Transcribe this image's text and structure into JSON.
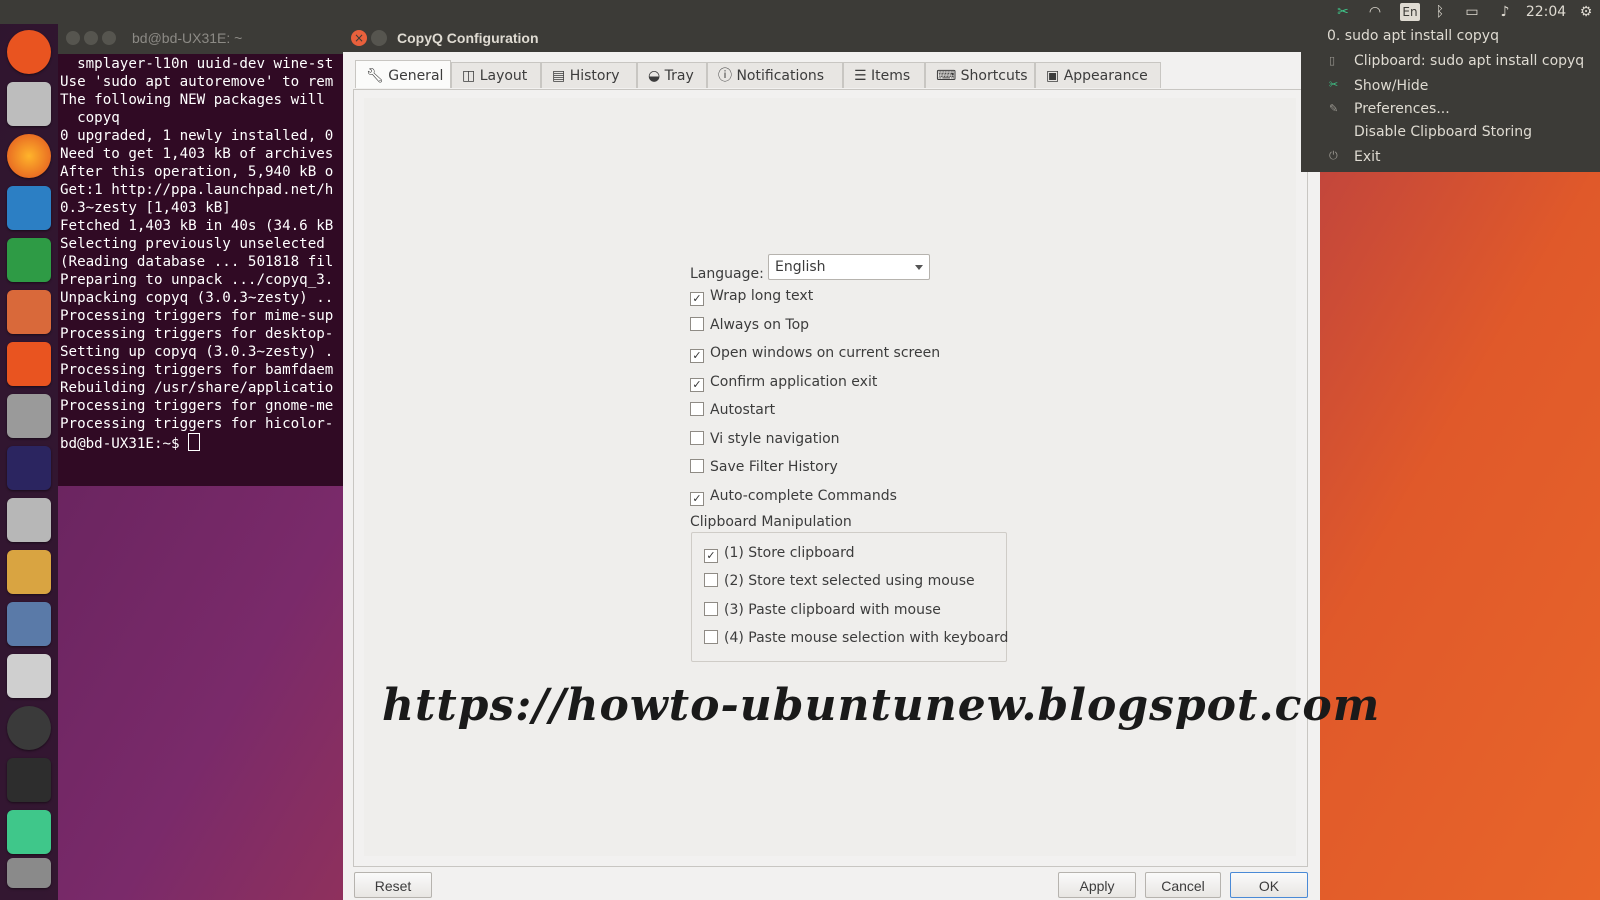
{
  "topbar": {
    "lang": "En",
    "time": "22:04"
  },
  "terminal": {
    "title": "bd@bd-UX31E: ~",
    "lines": [
      "  smplayer-l10n uuid-dev wine-st",
      "Use 'sudo apt autoremove' to rem",
      "The following NEW packages will ",
      "  copyq",
      "0 upgraded, 1 newly installed, 0",
      "Need to get 1,403 kB of archives",
      "After this operation, 5,940 kB o",
      "Get:1 http://ppa.launchpad.net/h",
      "0.3~zesty [1,403 kB]",
      "Fetched 1,403 kB in 40s (34.6 kB",
      "Selecting previously unselected ",
      "(Reading database ... 501818 fil",
      "Preparing to unpack .../copyq_3.",
      "Unpacking copyq (3.0.3~zesty) ..",
      "Processing triggers for mime-sup",
      "Processing triggers for desktop-",
      "Setting up copyq (3.0.3~zesty) .",
      "Processing triggers for bamfdaem",
      "Rebuilding /usr/share/applicatio",
      "Processing triggers for gnome-me",
      "Processing triggers for hicolor-"
    ],
    "prompt": "bd@bd-UX31E:~$ "
  },
  "dialog": {
    "title": "CopyQ Configuration",
    "tabs": [
      {
        "label": "General",
        "icon": "wrench-icon"
      },
      {
        "label": "Layout",
        "icon": "layout-icon"
      },
      {
        "label": "History",
        "icon": "history-icon"
      },
      {
        "label": "Tray",
        "icon": "tray-icon"
      },
      {
        "label": "Notifications",
        "icon": "info-icon"
      },
      {
        "label": "Items",
        "icon": "list-icon"
      },
      {
        "label": "Shortcuts",
        "icon": "keyboard-icon"
      },
      {
        "label": "Appearance",
        "icon": "image-icon"
      }
    ],
    "general": {
      "language_label": "Language:",
      "language_value": "English",
      "options": [
        {
          "label": "Wrap long text",
          "checked": true
        },
        {
          "label": "Always on Top",
          "checked": false
        },
        {
          "label": "Open windows on current screen",
          "checked": true
        },
        {
          "label": "Confirm application exit",
          "checked": true
        },
        {
          "label": "Autostart",
          "checked": false
        },
        {
          "label": "Vi style navigation",
          "checked": false
        },
        {
          "label": "Save Filter History",
          "checked": false
        },
        {
          "label": "Auto-complete Commands",
          "checked": true
        }
      ],
      "clipboard_group_label": "Clipboard Manipulation",
      "clipboard_options": [
        {
          "label": "(1) Store clipboard",
          "checked": true
        },
        {
          "label": "(2) Store text selected using mouse",
          "checked": false
        },
        {
          "label": "(3) Paste clipboard with mouse",
          "checked": false
        },
        {
          "label": "(4) Paste mouse selection with keyboard",
          "checked": false
        }
      ]
    },
    "watermark": "https://howto-ubuntunew.blogspot.com",
    "buttons": {
      "reset": "Reset",
      "apply": "Apply",
      "cancel": "Cancel",
      "ok": "OK"
    }
  },
  "tray_menu": {
    "items": [
      "0. sudo apt install copyq",
      "Clipboard: sudo apt install copyq",
      "Show/Hide",
      "Preferences...",
      "Disable Clipboard Storing",
      "Exit"
    ]
  },
  "colors": {
    "accent": "#e8603c",
    "panel": "#3c3b37",
    "terminal_bg": "#300a24"
  }
}
